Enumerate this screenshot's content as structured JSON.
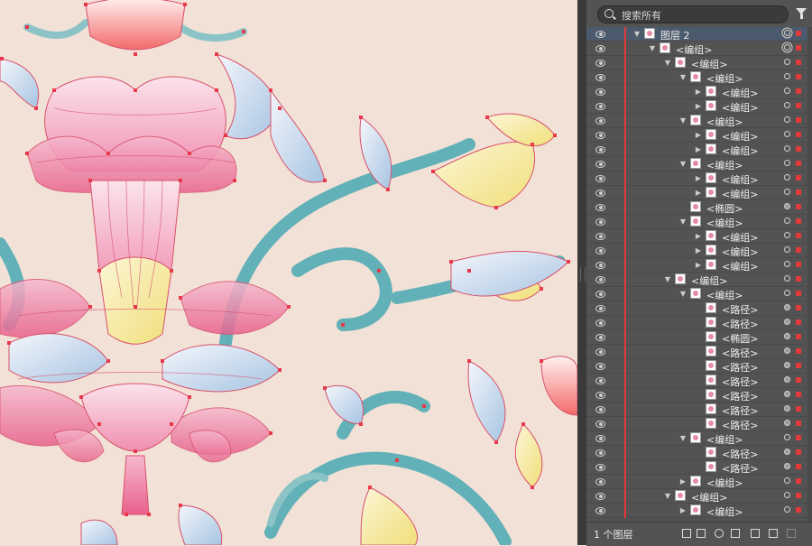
{
  "search": {
    "placeholder": "搜索所有"
  },
  "footer": {
    "layer_count": "1 个图层"
  },
  "layers": [
    {
      "label": "图层 2",
      "depth": 0,
      "arrow": "down",
      "selected": true,
      "target": "dbl"
    },
    {
      "label": "<编组>",
      "depth": 1,
      "arrow": "down",
      "target": "dbl"
    },
    {
      "label": "<编组>",
      "depth": 2,
      "arrow": "down",
      "target": "open"
    },
    {
      "label": "<编组>",
      "depth": 3,
      "arrow": "down",
      "target": "open"
    },
    {
      "label": "<编组>",
      "depth": 4,
      "arrow": "right",
      "target": "open"
    },
    {
      "label": "<编组>",
      "depth": 4,
      "arrow": "right",
      "target": "open"
    },
    {
      "label": "<编组>",
      "depth": 3,
      "arrow": "down",
      "target": "open"
    },
    {
      "label": "<编组>",
      "depth": 4,
      "arrow": "right",
      "target": "open"
    },
    {
      "label": "<编组>",
      "depth": 4,
      "arrow": "right",
      "target": "open"
    },
    {
      "label": "<编组>",
      "depth": 3,
      "arrow": "down",
      "target": "open"
    },
    {
      "label": "<编组>",
      "depth": 4,
      "arrow": "right",
      "target": "open"
    },
    {
      "label": "<编组>",
      "depth": 4,
      "arrow": "right",
      "target": "open"
    },
    {
      "label": "<椭圆>",
      "depth": 3,
      "arrow": "none",
      "target": "fill"
    },
    {
      "label": "<编组>",
      "depth": 3,
      "arrow": "down",
      "target": "open"
    },
    {
      "label": "<编组>",
      "depth": 4,
      "arrow": "right",
      "target": "open"
    },
    {
      "label": "<编组>",
      "depth": 4,
      "arrow": "right",
      "target": "open"
    },
    {
      "label": "<编组>",
      "depth": 4,
      "arrow": "right",
      "target": "open"
    },
    {
      "label": "<编组>",
      "depth": 2,
      "arrow": "down",
      "target": "open"
    },
    {
      "label": "<编组>",
      "depth": 3,
      "arrow": "down",
      "target": "open"
    },
    {
      "label": "<路径>",
      "depth": 4,
      "arrow": "none",
      "target": "fill"
    },
    {
      "label": "<路径>",
      "depth": 4,
      "arrow": "none",
      "target": "fill"
    },
    {
      "label": "<椭圆>",
      "depth": 4,
      "arrow": "none",
      "target": "fill"
    },
    {
      "label": "<路径>",
      "depth": 4,
      "arrow": "none",
      "target": "fill"
    },
    {
      "label": "<路径>",
      "depth": 4,
      "arrow": "none",
      "target": "fill"
    },
    {
      "label": "<路径>",
      "depth": 4,
      "arrow": "none",
      "target": "fill"
    },
    {
      "label": "<路径>",
      "depth": 4,
      "arrow": "none",
      "target": "fill"
    },
    {
      "label": "<路径>",
      "depth": 4,
      "arrow": "none",
      "target": "fill"
    },
    {
      "label": "<路径>",
      "depth": 4,
      "arrow": "none",
      "target": "fill"
    },
    {
      "label": "<编组>",
      "depth": 3,
      "arrow": "down",
      "target": "open"
    },
    {
      "label": "<路径>",
      "depth": 4,
      "arrow": "none",
      "target": "fill"
    },
    {
      "label": "<路径>",
      "depth": 4,
      "arrow": "none",
      "target": "fill"
    },
    {
      "label": "<编组>",
      "depth": 3,
      "arrow": "right",
      "target": "open"
    },
    {
      "label": "<编组>",
      "depth": 2,
      "arrow": "down",
      "target": "open"
    },
    {
      "label": "<编组>",
      "depth": 3,
      "arrow": "right",
      "target": "open"
    }
  ]
}
